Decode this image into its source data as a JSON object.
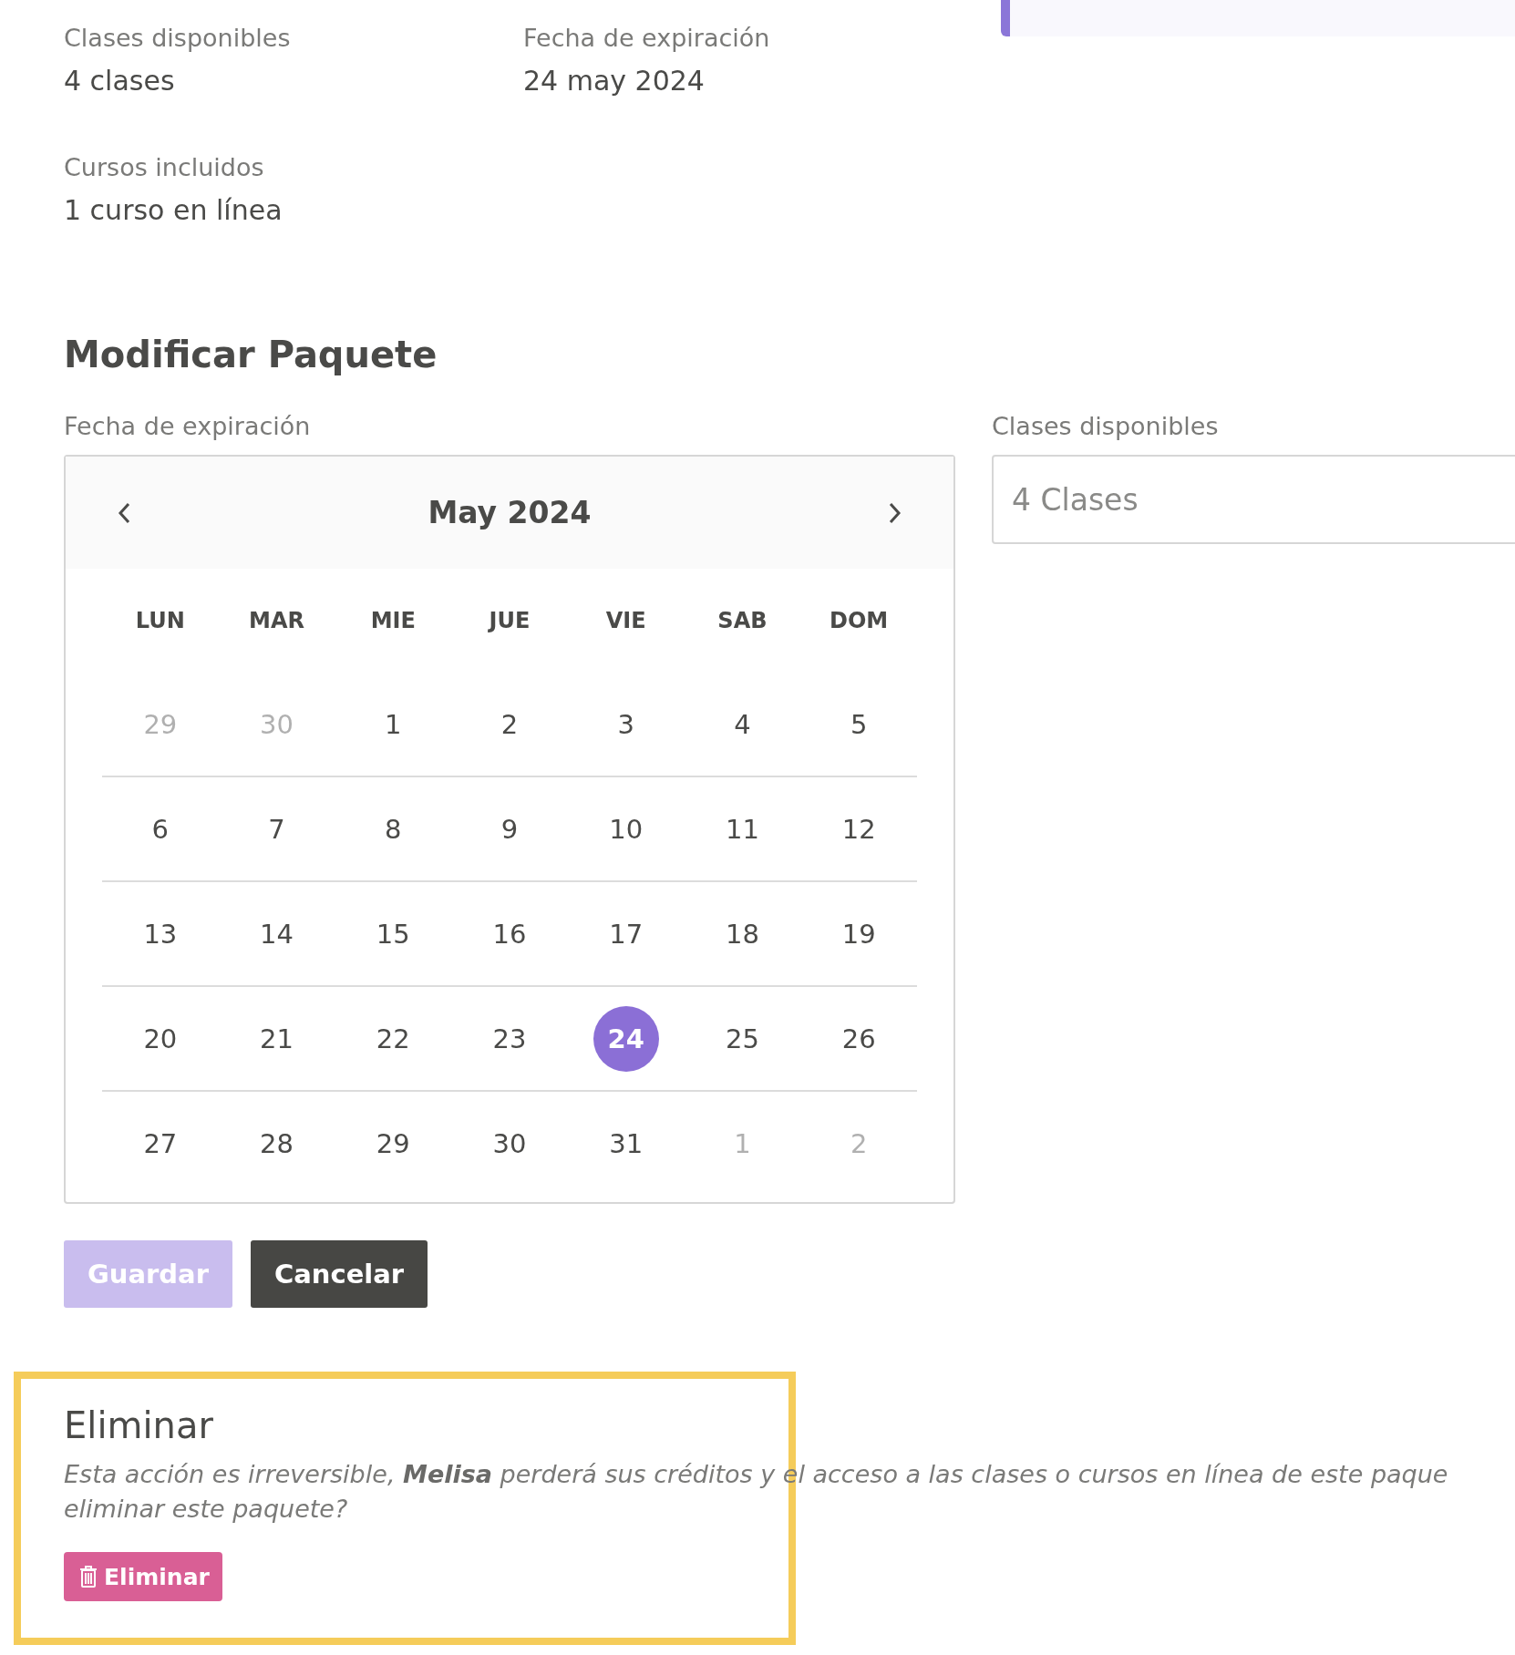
{
  "summary": {
    "items": [
      {
        "label": "Clases disponibles",
        "value": "4 clases"
      },
      {
        "label": "Fecha de expiración",
        "value": "24 may 2024"
      },
      {
        "label": "Cursos incluidos",
        "value": "1 curso en línea"
      }
    ]
  },
  "modify": {
    "title": "Modificar Paquete",
    "date_label": "Fecha de expiración",
    "classes_label": "Clases disponibles",
    "classes_value": "4 Clases",
    "calendar": {
      "month": "May 2024",
      "weekdays": [
        "LUN",
        "MAR",
        "MIE",
        "JUE",
        "VIE",
        "SAB",
        "DOM"
      ],
      "weeks": [
        [
          {
            "label": "29",
            "outside": true,
            "selected": false
          },
          {
            "label": "30",
            "outside": true,
            "selected": false
          },
          {
            "label": "1",
            "outside": false,
            "selected": false
          },
          {
            "label": "2",
            "outside": false,
            "selected": false
          },
          {
            "label": "3",
            "outside": false,
            "selected": false
          },
          {
            "label": "4",
            "outside": false,
            "selected": false
          },
          {
            "label": "5",
            "outside": false,
            "selected": false
          }
        ],
        [
          {
            "label": "6",
            "outside": false,
            "selected": false
          },
          {
            "label": "7",
            "outside": false,
            "selected": false
          },
          {
            "label": "8",
            "outside": false,
            "selected": false
          },
          {
            "label": "9",
            "outside": false,
            "selected": false
          },
          {
            "label": "10",
            "outside": false,
            "selected": false
          },
          {
            "label": "11",
            "outside": false,
            "selected": false
          },
          {
            "label": "12",
            "outside": false,
            "selected": false
          }
        ],
        [
          {
            "label": "13",
            "outside": false,
            "selected": false
          },
          {
            "label": "14",
            "outside": false,
            "selected": false
          },
          {
            "label": "15",
            "outside": false,
            "selected": false
          },
          {
            "label": "16",
            "outside": false,
            "selected": false
          },
          {
            "label": "17",
            "outside": false,
            "selected": false
          },
          {
            "label": "18",
            "outside": false,
            "selected": false
          },
          {
            "label": "19",
            "outside": false,
            "selected": false
          }
        ],
        [
          {
            "label": "20",
            "outside": false,
            "selected": false
          },
          {
            "label": "21",
            "outside": false,
            "selected": false
          },
          {
            "label": "22",
            "outside": false,
            "selected": false
          },
          {
            "label": "23",
            "outside": false,
            "selected": false
          },
          {
            "label": "24",
            "outside": false,
            "selected": true
          },
          {
            "label": "25",
            "outside": false,
            "selected": false
          },
          {
            "label": "26",
            "outside": false,
            "selected": false
          }
        ],
        [
          {
            "label": "27",
            "outside": false,
            "selected": false
          },
          {
            "label": "28",
            "outside": false,
            "selected": false
          },
          {
            "label": "29",
            "outside": false,
            "selected": false
          },
          {
            "label": "30",
            "outside": false,
            "selected": false
          },
          {
            "label": "31",
            "outside": false,
            "selected": false
          },
          {
            "label": "1",
            "outside": true,
            "selected": false
          },
          {
            "label": "2",
            "outside": true,
            "selected": false
          }
        ]
      ]
    },
    "buttons": [
      {
        "label": "Guardar",
        "kind": "primary",
        "disabled": true
      },
      {
        "label": "Cancelar",
        "kind": "secondary",
        "disabled": false
      }
    ]
  },
  "delete": {
    "title": "Eliminar",
    "message": "Esta acción es irreversible, **Melisa** perderá sus créditos y el acceso a las clases o cursos en línea de este paque\neliminar este paquete?",
    "button": "Eliminar"
  }
}
